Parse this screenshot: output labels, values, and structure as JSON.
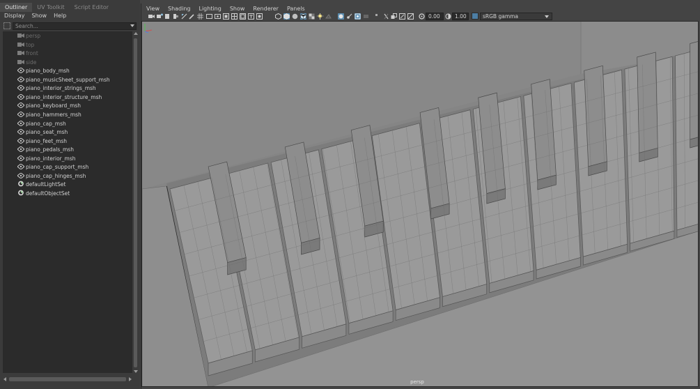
{
  "outliner": {
    "tabs": [
      {
        "label": "Outliner"
      },
      {
        "label": "UV Toolkit"
      },
      {
        "label": "Script Editor"
      }
    ],
    "menu": [
      {
        "label": "Display"
      },
      {
        "label": "Show"
      },
      {
        "label": "Help"
      }
    ],
    "search": {
      "placeholder": "Search..."
    },
    "items": [
      {
        "label": "persp",
        "type": "camera",
        "icon": "camera-icon"
      },
      {
        "label": "top",
        "type": "camera",
        "icon": "camera-icon"
      },
      {
        "label": "front",
        "type": "camera",
        "icon": "camera-icon"
      },
      {
        "label": "side",
        "type": "camera",
        "icon": "camera-icon"
      },
      {
        "label": "piano_body_msh",
        "type": "mesh",
        "icon": "transform-icon"
      },
      {
        "label": "piano_musicSheet_support_msh",
        "type": "mesh",
        "icon": "transform-icon"
      },
      {
        "label": "piano_interior_strings_msh",
        "type": "mesh",
        "icon": "transform-icon"
      },
      {
        "label": "piano_interior_structure_msh",
        "type": "mesh",
        "icon": "transform-icon"
      },
      {
        "label": "piano_keyboard_msh",
        "type": "mesh",
        "icon": "transform-icon"
      },
      {
        "label": "piano_hammers_msh",
        "type": "mesh",
        "icon": "transform-icon"
      },
      {
        "label": "piano_cap_msh",
        "type": "mesh",
        "icon": "transform-icon"
      },
      {
        "label": "piano_seat_msh",
        "type": "mesh",
        "icon": "transform-icon"
      },
      {
        "label": "piano_feet_msh",
        "type": "mesh",
        "icon": "transform-icon"
      },
      {
        "label": "piano_pedals_msh",
        "type": "mesh",
        "icon": "transform-icon"
      },
      {
        "label": "piano_interior_msh",
        "type": "mesh",
        "icon": "transform-icon"
      },
      {
        "label": "piano_cap_support_msh",
        "type": "mesh",
        "icon": "transform-icon"
      },
      {
        "label": "piano_cap_hinges_msh",
        "type": "mesh",
        "icon": "transform-icon"
      },
      {
        "label": "defaultLightSet",
        "type": "set",
        "icon": "set-icon"
      },
      {
        "label": "defaultObjectSet",
        "type": "set",
        "icon": "set-icon"
      }
    ]
  },
  "viewport": {
    "menu": [
      {
        "label": "View"
      },
      {
        "label": "Shading"
      },
      {
        "label": "Lighting"
      },
      {
        "label": "Show"
      },
      {
        "label": "Renderer"
      },
      {
        "label": "Panels"
      }
    ],
    "toolbar": {
      "exposure_value": "0.00",
      "gamma_value": "1.00",
      "color_space": "sRGB gamma"
    },
    "camera_label": "persp"
  },
  "colors": {
    "panel_bg": "#444444",
    "list_bg": "#2b2b2b",
    "highlight": "#5b8db0",
    "viewport_bg": "#848484"
  }
}
